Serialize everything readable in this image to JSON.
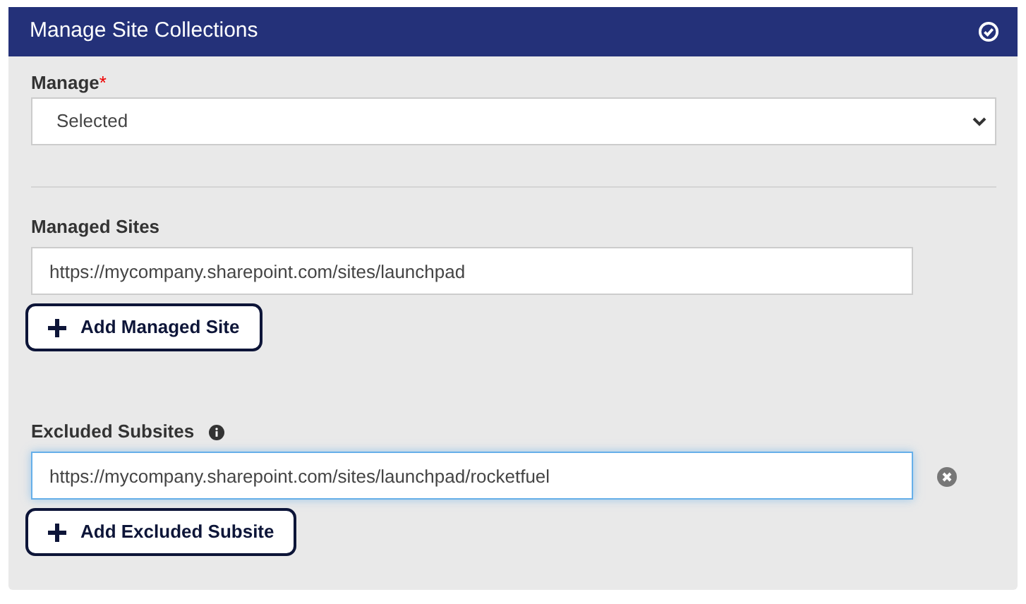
{
  "panel": {
    "title": "Manage Site Collections"
  },
  "manage": {
    "label": "Manage",
    "required_mark": "*",
    "value": "Selected"
  },
  "managed_sites": {
    "label": "Managed Sites",
    "entries": [
      {
        "value": "https://mycompany.sharepoint.com/sites/launchpad",
        "focused": false,
        "removable": false
      }
    ],
    "add_button": "Add Managed Site"
  },
  "excluded_subsites": {
    "label": "Excluded Subsites",
    "entries": [
      {
        "value": "https://mycompany.sharepoint.com/sites/launchpad/rocketfuel",
        "focused": true,
        "removable": true
      }
    ],
    "add_button": "Add Excluded Subsite"
  }
}
